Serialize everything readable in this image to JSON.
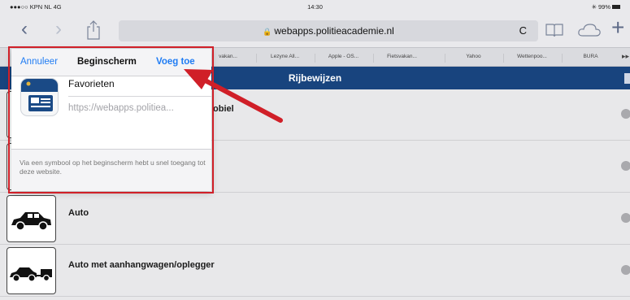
{
  "status": {
    "carrier": "●●●○○ KPN NL  4G",
    "time": "14:30",
    "battery": "✳ 99%"
  },
  "toolbar": {
    "back_glyph": "‹",
    "forward_glyph": "›",
    "url": "webapps.politieacademie.nl",
    "lock_glyph": "🔒",
    "reload_glyph": "C",
    "add_tab_glyph": "+"
  },
  "favorites": {
    "items": [
      "vakan...",
      "Lezyne All...",
      "Apple - OS...",
      "Fietsvakan...",
      "Yahoo",
      "Wettenpoo...",
      "BURA"
    ],
    "more": "▸▸"
  },
  "page": {
    "header_title": "Rijbewijzen",
    "rows": [
      {
        "label": "obiel"
      },
      {
        "label": ""
      },
      {
        "label": "Auto"
      },
      {
        "label": "Auto met aanhangwagen/oplegger"
      }
    ]
  },
  "popover": {
    "cancel_label": "Annuleer",
    "title": "Beginscherm",
    "add_label": "Voeg toe",
    "name_value": "Favorieten",
    "url_value": "https://webapps.politiea...",
    "description": "Via een symbool op het beginscherm hebt u snel toegang tot deze website."
  },
  "colors": {
    "accent_blue": "#1f7cf4",
    "header_blue": "#18447e",
    "highlight_red": "#d01f28"
  }
}
